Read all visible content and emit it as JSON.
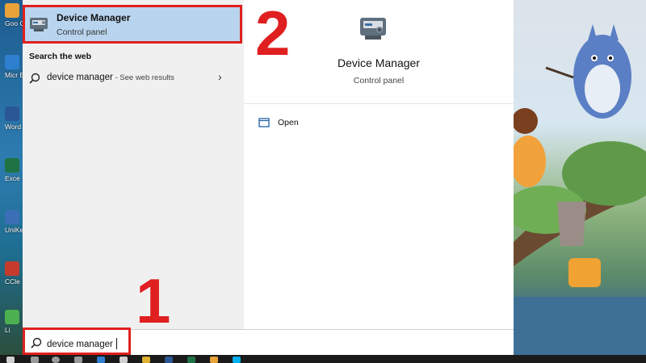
{
  "desktop": {
    "icons": [
      {
        "label": "Goo Chro",
        "color": "#e8a23a"
      },
      {
        "label": "Micr Ed",
        "color": "#2f7fd0"
      },
      {
        "label": "Word",
        "color": "#2b5797"
      },
      {
        "label": "Exce",
        "color": "#1f7244"
      },
      {
        "label": "UniKe Sho",
        "color": "#3a6fb5"
      },
      {
        "label": "CCle",
        "color": "#c43b2e"
      },
      {
        "label": "Li",
        "color": "#4caf50"
      }
    ]
  },
  "best_match": {
    "title": "Device Manager",
    "subtitle": "Control panel",
    "icon": "device-manager-icon"
  },
  "search_web": {
    "heading": "Search the web",
    "query": "device manager",
    "hint": " - See web results",
    "chevron": "›"
  },
  "detail": {
    "title": "Device Manager",
    "subtitle": "Control panel",
    "actions": [
      {
        "label": "Open",
        "icon": "open-window-icon"
      }
    ]
  },
  "search_bar": {
    "value": "device manager",
    "icon": "search-icon"
  },
  "annotations": {
    "step1": "1",
    "step2": "2",
    "color": "#e02020"
  },
  "taskbar": {
    "items": [
      "start-icon",
      "search-icon",
      "cortana-icon",
      "task-view-icon",
      "edge-icon",
      "store-icon",
      "explorer-icon",
      "word-icon",
      "excel-icon",
      "chrome-icon",
      "skype-icon"
    ]
  }
}
